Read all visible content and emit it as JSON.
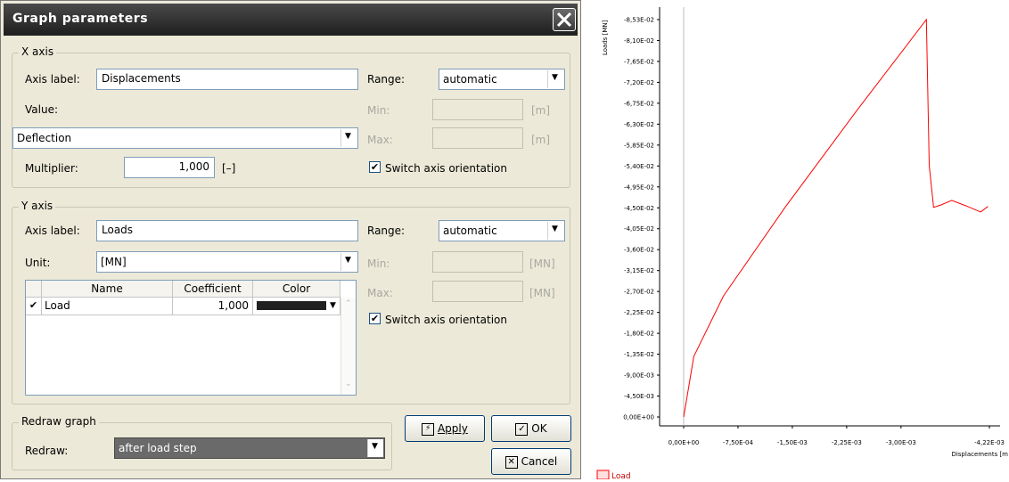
{
  "dialog": {
    "title": "Graph parameters",
    "x_axis": {
      "legend": "X axis",
      "axis_label_caption": "Axis label:",
      "axis_label_value": "Displacements",
      "value_caption": "Value:",
      "value_selected": "Deflection",
      "multiplier_caption": "Multiplier:",
      "multiplier_value": "1,000",
      "multiplier_unit": "[–]",
      "range_caption": "Range:",
      "range_selected": "automatic",
      "min_caption": "Min:",
      "max_caption": "Max:",
      "min_unit": "[m]",
      "max_unit": "[m]",
      "switch_orientation_label": "Switch axis orientation",
      "switch_orientation_checked": true
    },
    "y_axis": {
      "legend": "Y axis",
      "axis_label_caption": "Axis label:",
      "axis_label_value": "Loads",
      "unit_caption": "Unit:",
      "unit_selected": "[MN]",
      "range_caption": "Range:",
      "range_selected": "automatic",
      "min_caption": "Min:",
      "max_caption": "Max:",
      "min_unit": "[MN]",
      "max_unit": "[MN]",
      "switch_orientation_label": "Switch axis orientation",
      "switch_orientation_checked": true,
      "table": {
        "columns": [
          "Name",
          "Coefficient",
          "Color"
        ],
        "rows": [
          {
            "checked": true,
            "name": "Load",
            "coefficient": "1,000",
            "color": "#202020"
          }
        ]
      }
    },
    "redraw": {
      "legend": "Redraw graph",
      "caption": "Redraw:",
      "selected": "after load step"
    },
    "buttons": {
      "apply": "Apply",
      "ok": "OK",
      "cancel": "Cancel"
    }
  },
  "chart_data": {
    "type": "line",
    "ylabel": "Loads [MN]",
    "xlabel": "Displacements [m",
    "y_tick_labels": [
      "-8,53E-02",
      "-8,10E-02",
      "-7,65E-02",
      "-7,20E-02",
      "-6,75E-02",
      "-6,30E-02",
      "-5,85E-02",
      "-5,40E-02",
      "-4,95E-02",
      "-4,50E-02",
      "-4,05E-02",
      "-3,60E-02",
      "-3,15E-02",
      "-2,70E-02",
      "-2,25E-02",
      "-1,80E-02",
      "-1,35E-02",
      "-9,00E-03",
      "-4,50E-03",
      "0,00E+00"
    ],
    "x_tick_labels": [
      "0,00E+00",
      "-7,50E-04",
      "-1,50E-03",
      "-2,25E-03",
      "-3,00E-03",
      "-4,22E-03"
    ],
    "x_range": [
      0,
      -0.00422
    ],
    "y_range": [
      0,
      -0.0853
    ],
    "axis_orientation_switched": true,
    "series": [
      {
        "name": "Load",
        "color": "#ff0000",
        "x": [
          0,
          -0.00014,
          -0.00055,
          -0.0014,
          -0.0024,
          -0.00335,
          -0.00339,
          -0.00345,
          -0.00355,
          -0.0037,
          -0.0039,
          -0.0041,
          -0.0042
        ],
        "y": [
          0,
          -0.013,
          -0.026,
          -0.045,
          -0.066,
          -0.0853,
          -0.054,
          -0.045,
          -0.0455,
          -0.0465,
          -0.0453,
          -0.044,
          -0.0452
        ]
      }
    ],
    "legend_position": "bottom-left",
    "grid": false
  }
}
